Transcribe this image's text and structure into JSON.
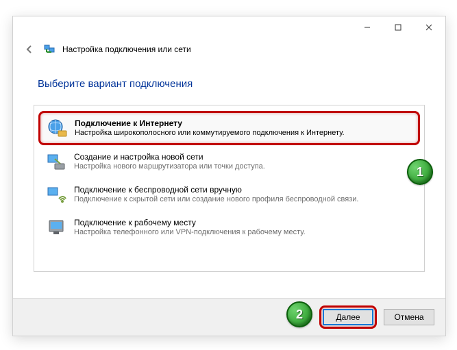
{
  "window": {
    "title": "Настройка подключения или сети"
  },
  "heading": "Выберите вариант подключения",
  "options": [
    {
      "title": "Подключение к Интернету",
      "desc": "Настройка широкополосного или коммутируемого подключения к Интернету.",
      "selected": true
    },
    {
      "title": "Создание и настройка новой сети",
      "desc": "Настройка нового маршрутизатора или точки доступа."
    },
    {
      "title": "Подключение к беспроводной сети вручную",
      "desc": "Подключение к скрытой сети или создание нового профиля беспроводной связи."
    },
    {
      "title": "Подключение к рабочему месту",
      "desc": "Настройка телефонного или VPN-подключения к рабочему месту."
    }
  ],
  "footer": {
    "next": "Далее",
    "cancel": "Отмена"
  },
  "annotations": {
    "b1": "1",
    "b2": "2"
  }
}
